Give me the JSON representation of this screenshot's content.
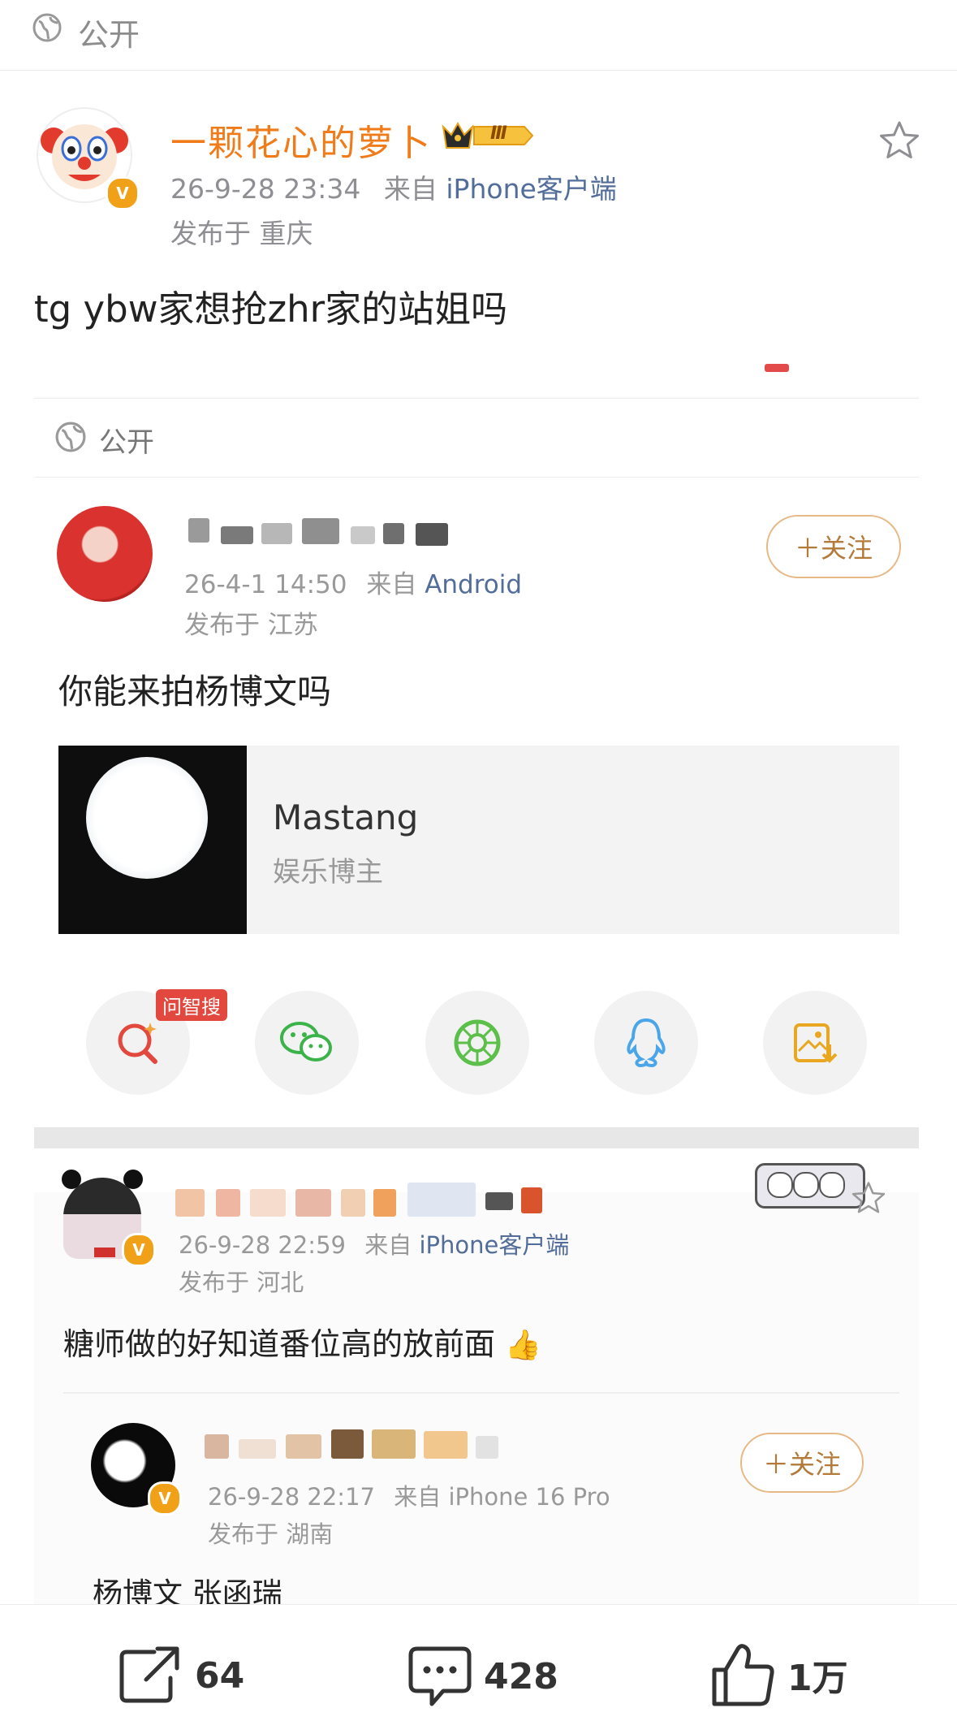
{
  "topbar": {
    "visibility_label": "公开",
    "visibility_icon": "globe-icon"
  },
  "post": {
    "username": "一颗花心的萝卜",
    "level_badge": "Ⅲ",
    "timestamp": "26-9-28 23:34",
    "source_prefix": "来自",
    "source": "iPhone客户端",
    "location": "发布于 重庆",
    "text": "tg ybw家想抢zhr家的站姐吗"
  },
  "embedded": {
    "visibility_label": "公开",
    "user1": {
      "timestamp": "26-4-1 14:50",
      "source_prefix": "来自",
      "source": "Android",
      "location": "发布于 江苏",
      "follow_label": "＋关注"
    },
    "text1": "你能来拍杨博文吗",
    "card": {
      "title": "Mastang",
      "subtitle": "娱乐博主"
    },
    "share": {
      "search_badge": "问智搜",
      "icons": [
        "search-ai-icon",
        "wechat-icon",
        "moments-icon",
        "qq-icon",
        "save-image-icon"
      ]
    },
    "user2": {
      "timestamp": "26-9-28 22:59",
      "source_prefix": "来自",
      "source": "iPhone客户端",
      "location": "发布于 河北"
    },
    "text2": "糖师做的好知道番位高的放前面",
    "user3": {
      "timestamp": "26-9-28 22:17",
      "source_prefix": "来自",
      "source": "iPhone 16 Pro",
      "location": "发布于 湖南",
      "follow_label": "＋关注"
    },
    "text3": "杨博文 张函瑞"
  },
  "actions": {
    "repost_count": "64",
    "comment_count": "428",
    "like_count": "1万"
  },
  "colors": {
    "username": "#f07b18",
    "source_link": "#526d99",
    "badge": "#f0a118"
  }
}
